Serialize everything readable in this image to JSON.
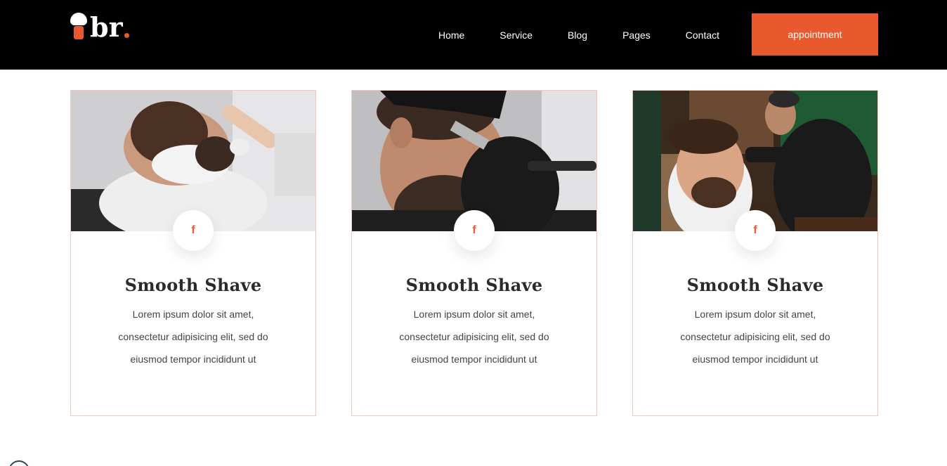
{
  "header": {
    "logo_text": "br",
    "nav": [
      "Home",
      "Service",
      "Blog",
      "Pages",
      "Contact"
    ],
    "cta_label": "appointment"
  },
  "colors": {
    "accent": "#e85a2d",
    "header_bg": "#000000",
    "card_border": "#f0c8bc"
  },
  "cards": [
    {
      "title": "Smooth Shave",
      "icon": "facebook-icon",
      "icon_glyph": "f",
      "text": "Lorem ipsum dolor sit amet, consectetur adipisicing elit, sed do eiusmod tempor incididunt ut"
    },
    {
      "title": "Smooth Shave",
      "icon": "facebook-icon",
      "icon_glyph": "f",
      "text": "Lorem ipsum dolor sit amet, consectetur adipisicing elit, sed do eiusmod tempor incididunt ut"
    },
    {
      "title": "Smooth Shave",
      "icon": "facebook-icon",
      "icon_glyph": "f",
      "text": "Lorem ipsum dolor sit amet, consectetur adipisicing elit, sed do eiusmod tempor incididunt ut"
    }
  ]
}
